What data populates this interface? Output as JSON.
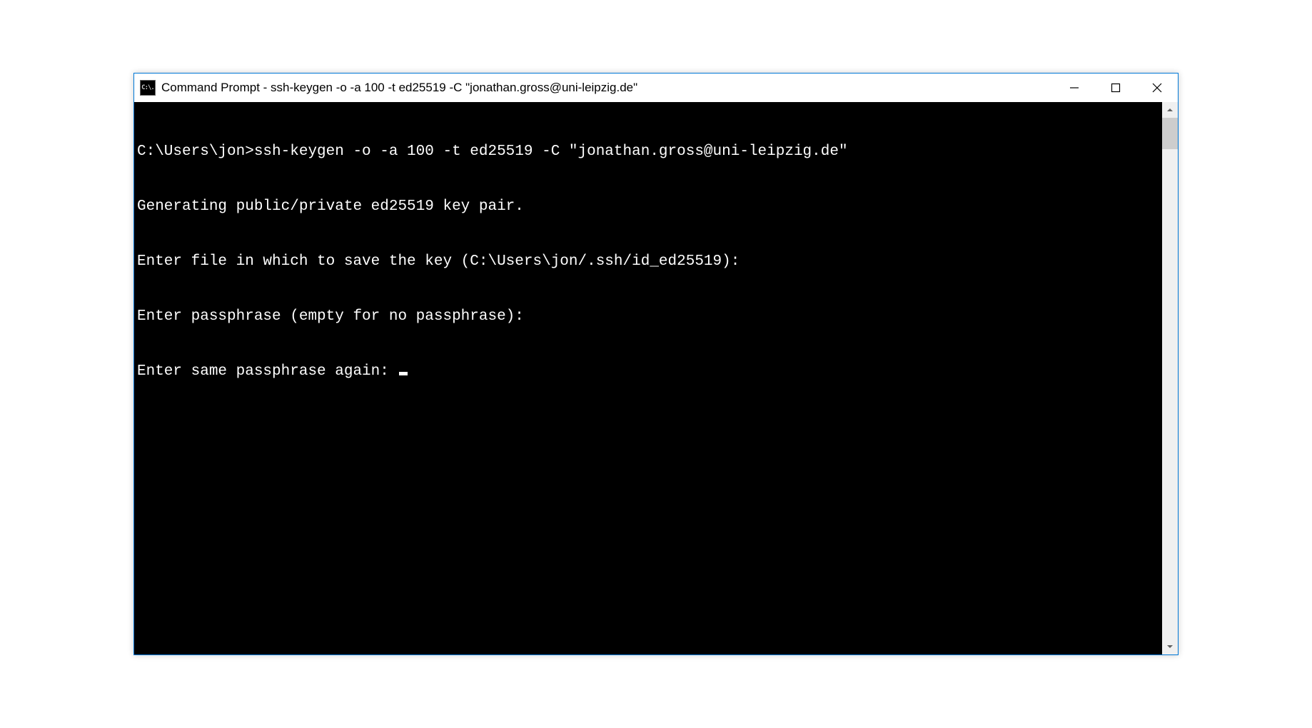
{
  "window": {
    "title": "Command Prompt - ssh-keygen  -o -a 100 -t ed25519 -C \"jonathan.gross@uni-leipzig.de\"",
    "icon_text": "C:\\."
  },
  "terminal": {
    "lines": [
      "C:\\Users\\jon>ssh-keygen -o -a 100 -t ed25519 -C \"jonathan.gross@uni-leipzig.de\"",
      "Generating public/private ed25519 key pair.",
      "Enter file in which to save the key (C:\\Users\\jon/.ssh/id_ed25519):",
      "Enter passphrase (empty for no passphrase):",
      "Enter same passphrase again: "
    ]
  }
}
